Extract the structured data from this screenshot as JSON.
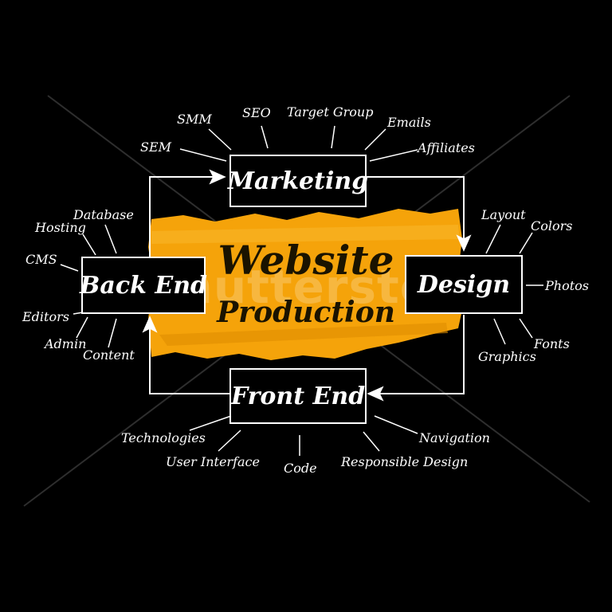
{
  "center": {
    "line1": "Website",
    "line2": "Production"
  },
  "nodes": {
    "marketing": "Marketing",
    "design": "Design",
    "frontend": "Front End",
    "backend": "Back End"
  },
  "marketing_items": [
    "SMM",
    "SEO",
    "Target Group",
    "Emails",
    "Affiliates",
    "SEM"
  ],
  "design_items": [
    "Layout",
    "Colors",
    "Photos",
    "Fonts",
    "Graphics"
  ],
  "frontend_items": [
    "Technologies",
    "User Interface",
    "Code",
    "Responsible Design",
    "Navigation"
  ],
  "backend_items": [
    "Database",
    "Hosting",
    "CMS",
    "Editors",
    "Admin",
    "Content"
  ],
  "watermark": "shutterstock",
  "colors": {
    "background": "#000000",
    "accent": "#F5A30A",
    "line": "#FFFFFF"
  }
}
